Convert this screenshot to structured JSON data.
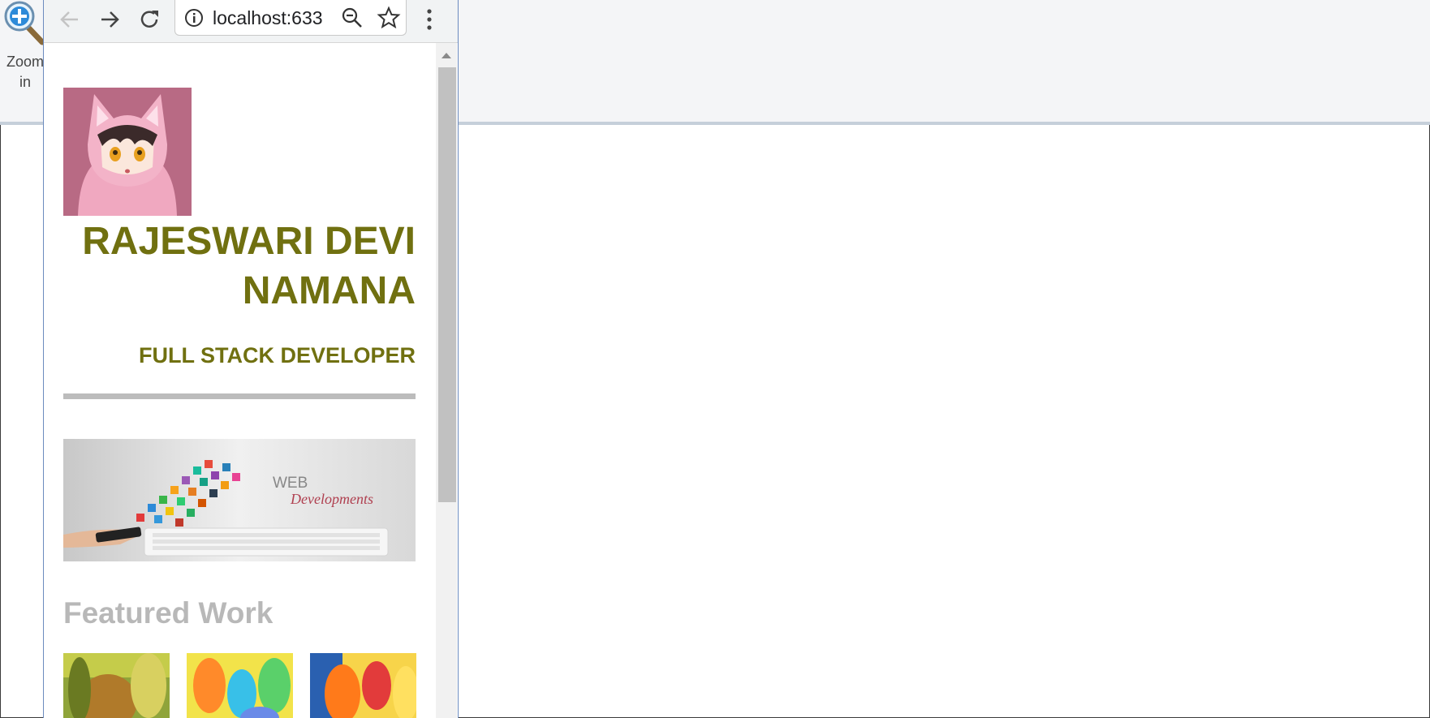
{
  "desktop": {
    "zoom_tool": {
      "label": "Zoom in",
      "icon": "zoom-in-icon"
    }
  },
  "browser": {
    "toolbar": {
      "back_icon": "arrow-left-icon",
      "forward_icon": "arrow-right-icon",
      "reload_icon": "reload-icon",
      "info_icon": "info-icon",
      "url": "localhost:633",
      "zoom_icon": "zoom-out-icon",
      "bookmark_icon": "star-icon",
      "menu_icon": "kebab-menu-icon"
    }
  },
  "page": {
    "name": "RAJESWARI DEVI NAMANA",
    "role": "FULL STACK DEVELOPER",
    "featured_heading": "Featured Work",
    "banner": {
      "word1": "WEB",
      "word2": "Developments"
    }
  },
  "colors": {
    "accent": "#707010",
    "muted_heading": "#b8b8b8",
    "divider": "#bcbcbc",
    "frame": "#6c8bbf"
  }
}
